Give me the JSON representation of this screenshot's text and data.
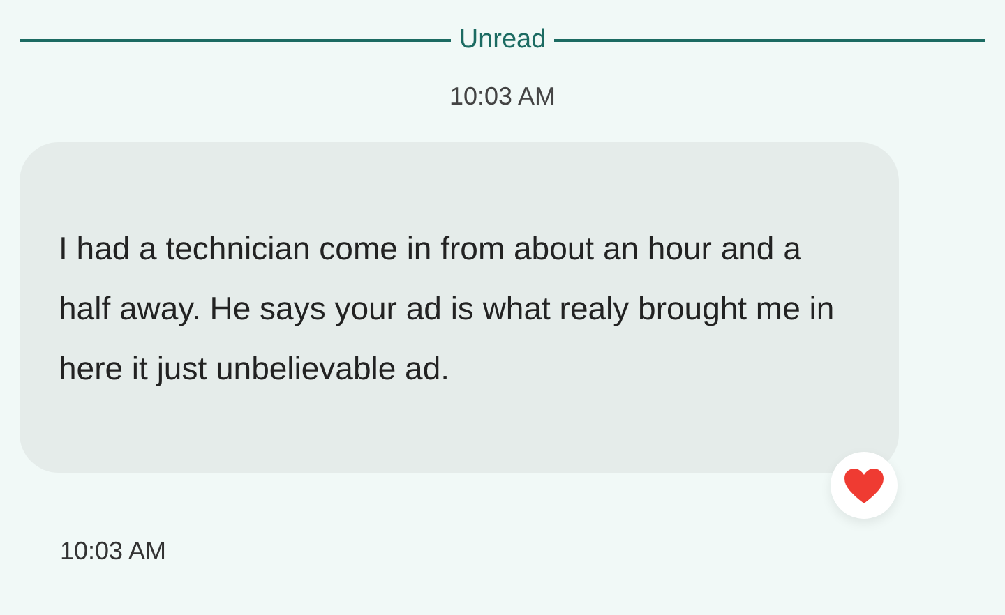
{
  "divider": {
    "label": "Unread"
  },
  "timestamp": "10:03 AM",
  "message": {
    "text": "I had a technician come in from about an hour and a half away. He says your ad is what realy brought me in here it just unbelievable ad.",
    "reaction": {
      "kind": "heart"
    },
    "time": "10:03 AM"
  }
}
